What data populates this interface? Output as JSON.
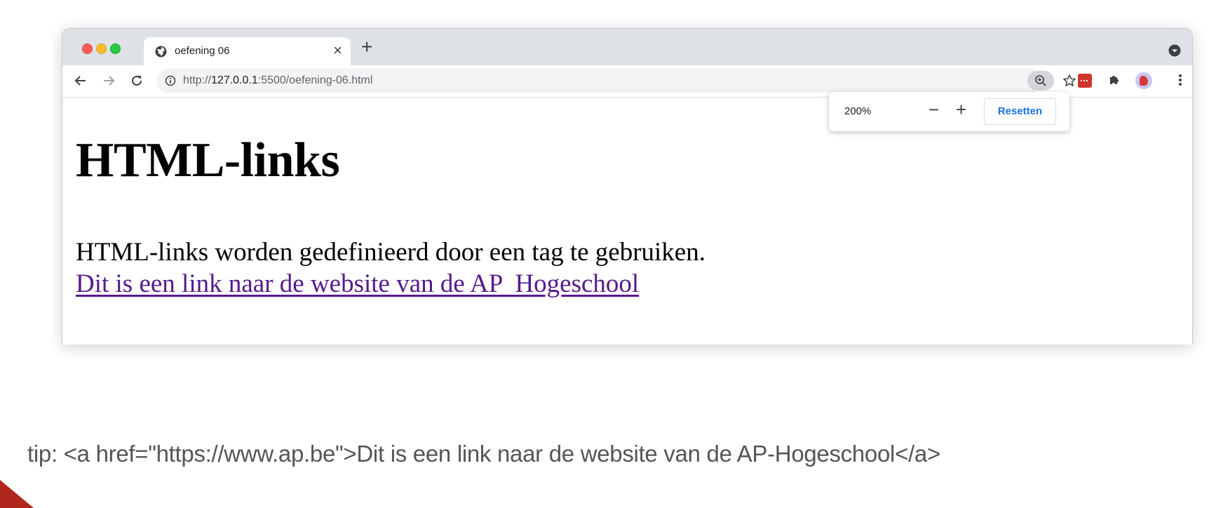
{
  "browser": {
    "tab": {
      "title": "oefening 06",
      "close_label": "×",
      "favicon": "globe-icon"
    },
    "new_tab_label": "+",
    "url": {
      "scheme": "http://",
      "host": "127.0.0.1",
      "rest": ":5500/oefening-06.html"
    },
    "zoom_popup": {
      "level": "200%",
      "minus_label": "−",
      "plus_label": "+",
      "reset_label": "Resetten"
    },
    "icons": [
      "back-icon",
      "forward-icon",
      "reload-icon",
      "info-icon",
      "zoom-icon",
      "star-icon",
      "extension-icon",
      "puzzle-icon",
      "avatar",
      "menu-icon",
      "tab-search-icon"
    ]
  },
  "page": {
    "heading": "HTML-links",
    "paragraph": "HTML-links worden gedefinieerd door een tag te gebruiken.",
    "link_text": "Dit is een link naar de website van de AP  Hogeschool"
  },
  "slide": {
    "tip": "tip: <a href=\"https://www.ap.be\">Dit is een link naar de website van de AP-Hogeschool</a>"
  },
  "colors": {
    "link": "#551a8b",
    "accent": "#1a73e8",
    "corner": "#b0261c"
  }
}
